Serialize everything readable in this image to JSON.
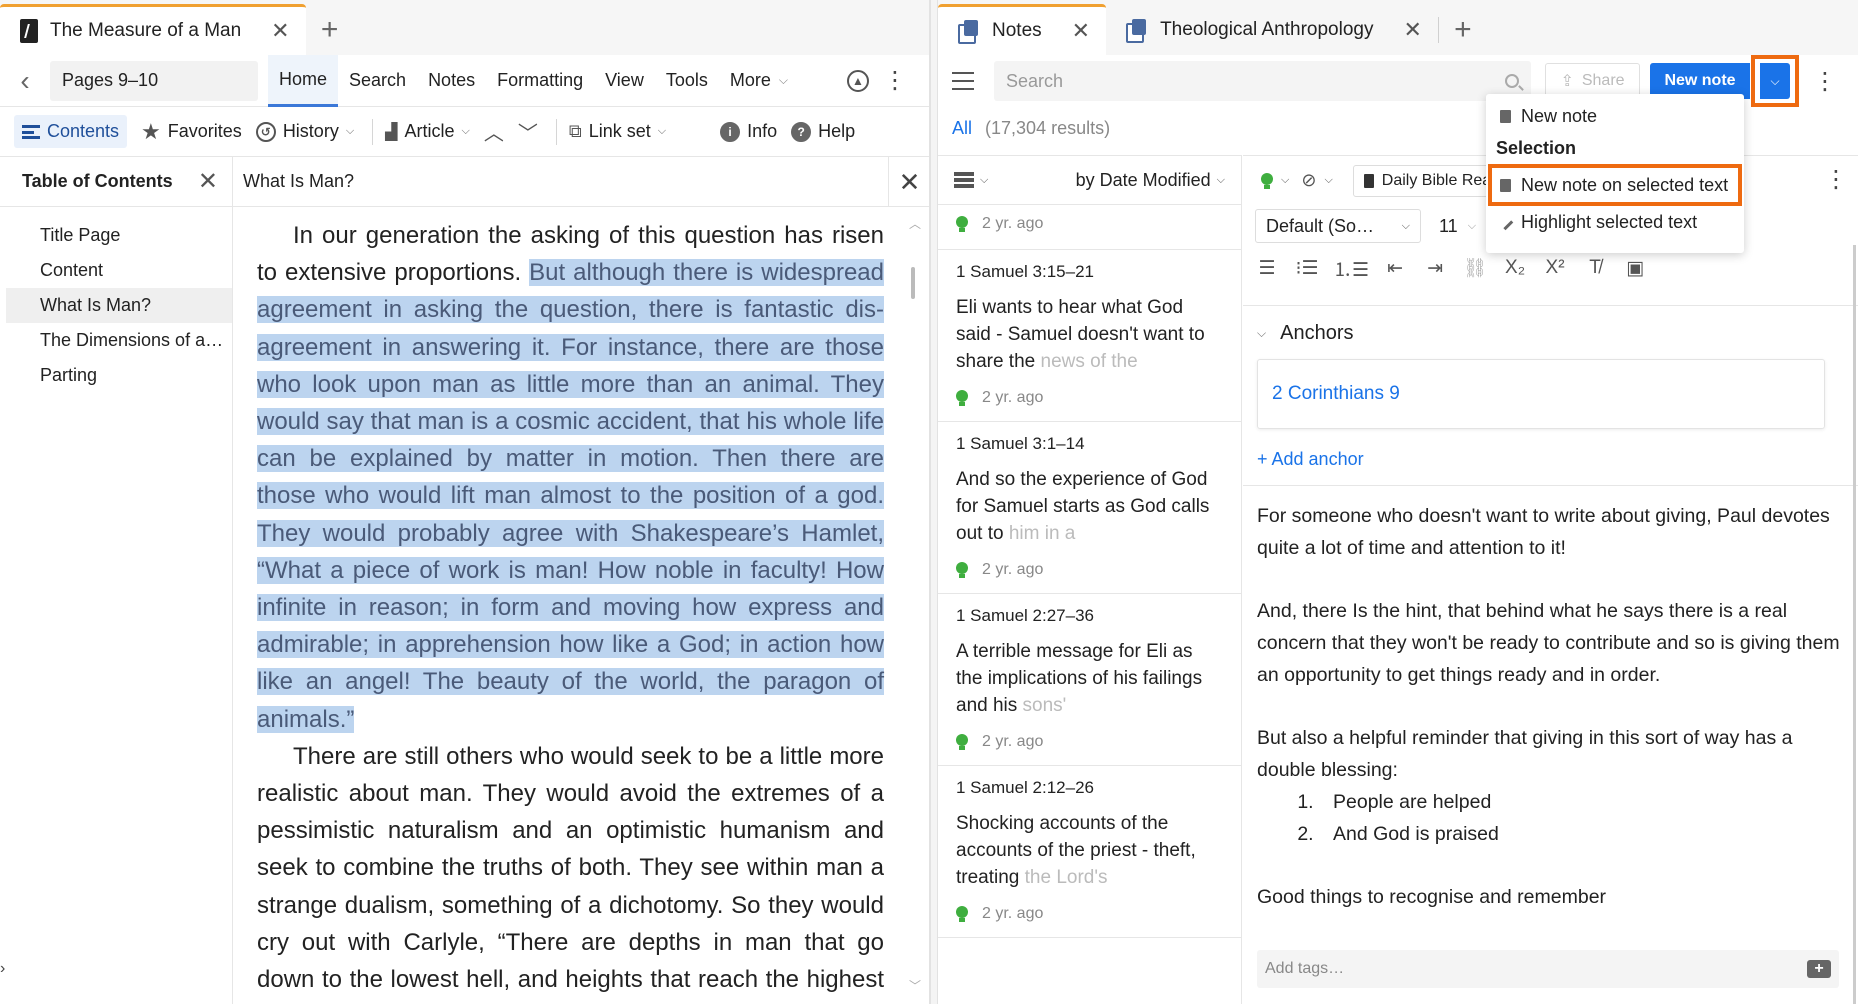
{
  "left": {
    "tab": {
      "title": "The Measure of a Man"
    },
    "toolbar": {
      "pages": "Pages 9–10",
      "menu": [
        "Home",
        "Search",
        "Notes",
        "Formatting",
        "View",
        "Tools",
        "More"
      ]
    },
    "toolbar2": {
      "contents": "Contents",
      "favorites": "Favorites",
      "history": "History",
      "article": "Article",
      "linkset": "Link set",
      "info": "Info",
      "help": "Help"
    },
    "toc": {
      "title": "Table of Contents",
      "items": [
        "Title Page",
        "Content",
        "What Is Man?",
        "The Dimensions of a…",
        "Parting"
      ]
    },
    "reader": {
      "section_title": "What Is Man?",
      "p1_start": "In our generation the asking of this question has risen to extensive proportions. ",
      "p1_highlight": "But although there is widespread agreement in asking the question, there is fantastic dis­agreement in answering it. For instance, there are those who look upon man as little more than an animal. They would say that man is a cosmic accident, that his whole life can be explained by matter in motion. Then there are those who would lift man almost to the position of a god. They would probably agree with Shakespeare’s Hamlet, “What a piece of work is man! How noble in faculty! How infinite in reason; in form and moving how express and admirable; in apprehen­sion how like a God; in action how like an angel! The beauty of the world, the paragon of animals.”",
      "p2": "There are still others who would seek to be a little more realistic about man. They would avoid the extremes of a pessimistic naturalism and an optimistic humanism and seek to combine the truths of both. They see within man a strange dualism, something of a dichotomy. So they would cry out with Carlyle, “There are depths in man that go down to the lowest hell, and heights that reach the highest heaven, for are not both heaven and hell made out of"
    }
  },
  "right": {
    "tabs": [
      {
        "title": "Notes"
      },
      {
        "title": "Theological Anthropology"
      }
    ],
    "toolbar": {
      "search_placeholder": "Search",
      "share": "Share",
      "new_note": "New note"
    },
    "results": {
      "all": "All",
      "count": "(17,304 results)"
    },
    "list": {
      "sort": "by Date Modified",
      "notes": [
        {
          "ref": "",
          "body": "",
          "fade": "",
          "age": "2 yr. ago"
        },
        {
          "ref": "1 Samuel 3:15–21",
          "body": "Eli wants to hear what God said - Samuel doesn't want to share the ",
          "fade": "news of the",
          "age": "2 yr. ago"
        },
        {
          "ref": "1 Samuel 3:1–14",
          "body": "And so the experience of God for Samuel starts as God calls out to ",
          "fade": "him in a",
          "age": "2 yr. ago"
        },
        {
          "ref": "1 Samuel 2:27–36",
          "body": "A terrible message for Eli as the implications of his failings and his ",
          "fade": "sons'",
          "age": "2 yr. ago"
        },
        {
          "ref": "1 Samuel 2:12–26",
          "body": "Shocking accounts of the accounts of the priest - theft, treating ",
          "fade": "the Lord's",
          "age": "2 yr. ago"
        }
      ]
    },
    "editor": {
      "notebook": "Daily Bible Reading",
      "font": "Default (So…",
      "size": "11",
      "anchors_title": "Anchors",
      "anchor": "2 Corinthians 9",
      "add_anchor": "+ Add anchor",
      "p1": "For someone who doesn't want to write about giving, Paul devotes quite a lot of time and attention to it!",
      "p2": "And, there Is the hint, that behind what he says there is a real concern that they won't be ready to contribute and so is giving them an opportunity to get things ready and in order.",
      "p3": "But also a helpful reminder that giving in this sort of way has a double blessing:",
      "list": [
        "People are helped",
        "And God is praised"
      ],
      "p4": "Good things to recognise and remember",
      "tags_placeholder": "Add tags…"
    },
    "dropdown": {
      "new_note": "New note",
      "section": "Selection",
      "on_selected": "New note on selected text",
      "highlight": "Highlight selected text"
    }
  },
  "colors": {
    "accent": "#1a73e8",
    "highlight_box": "#ee6a10",
    "selection": "#bcd4ef",
    "tab_active_top": "#f0a030"
  }
}
